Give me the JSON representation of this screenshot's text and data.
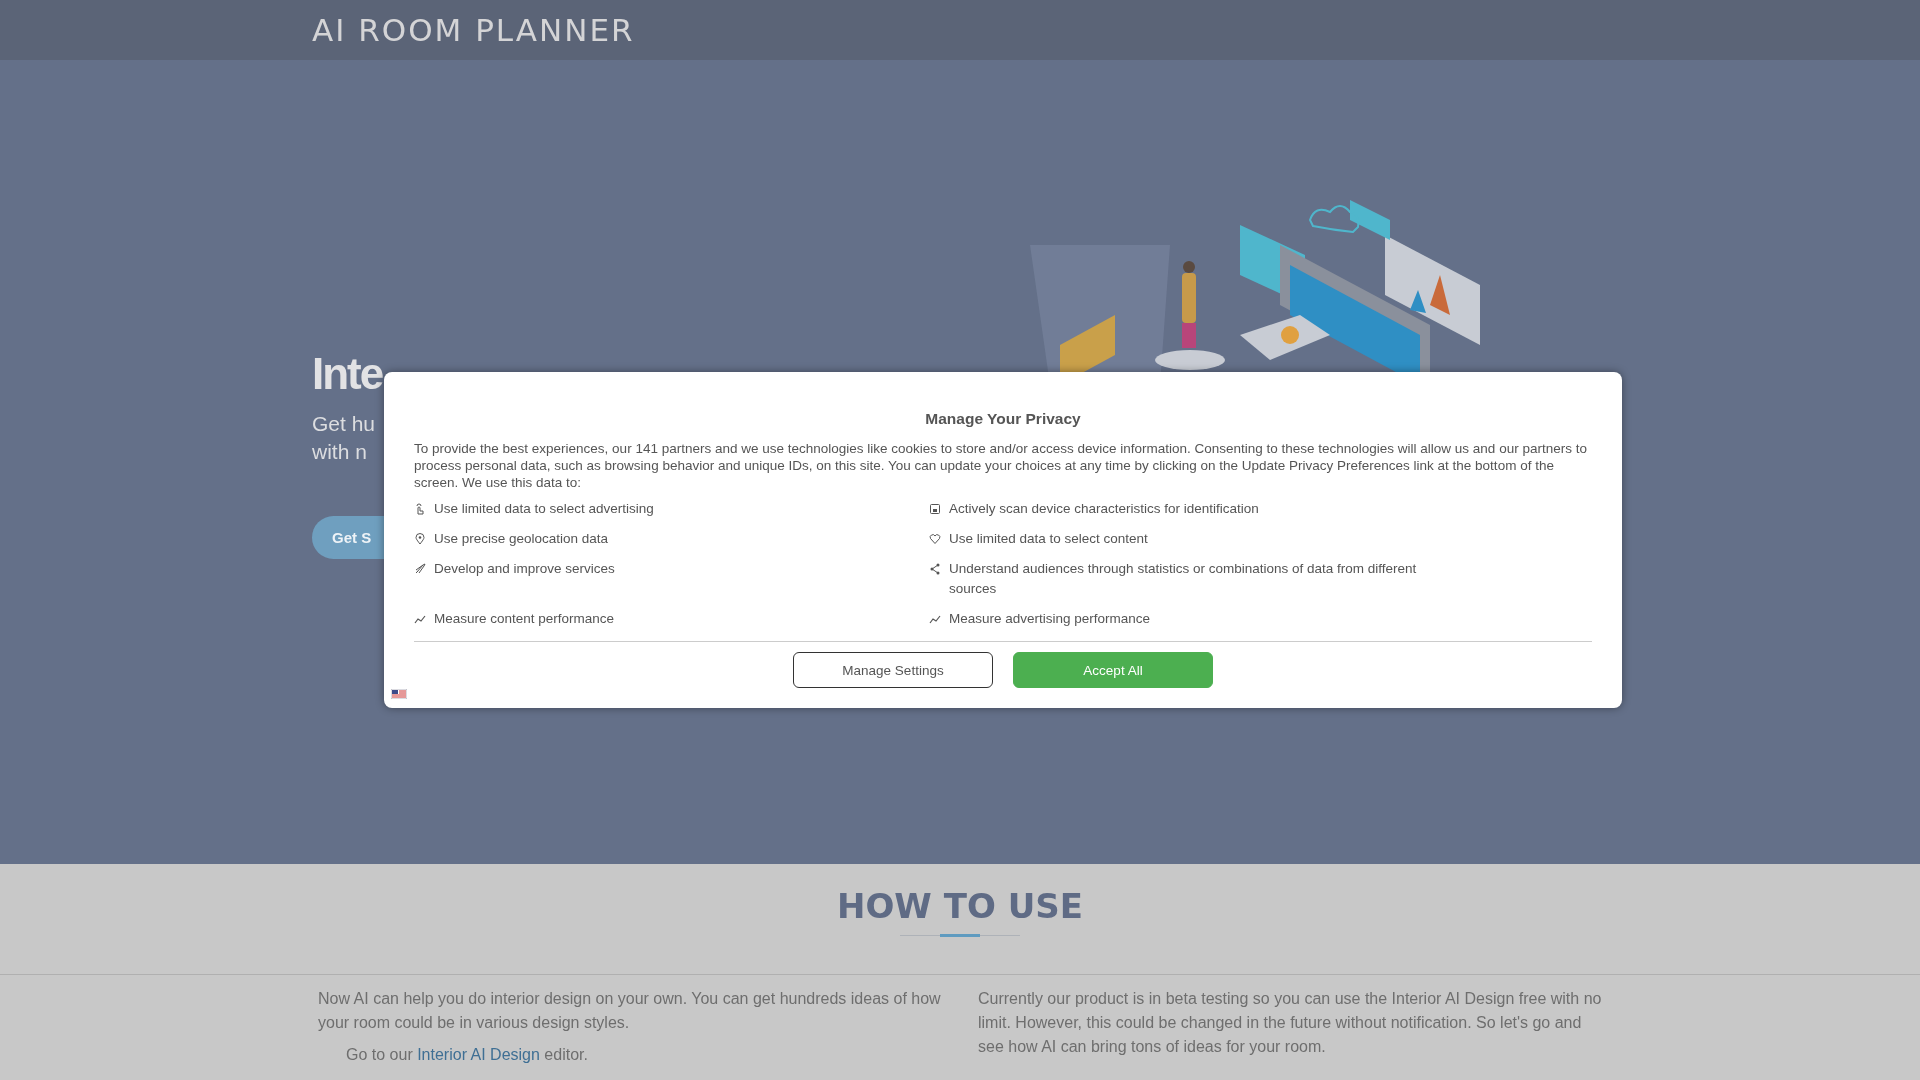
{
  "header": {
    "title": "AI ROOM PLANNER"
  },
  "hero": {
    "title": "Inte",
    "subtitle_lines": [
      "Get hu",
      "with n"
    ],
    "button": "Get S"
  },
  "privacy_dialog": {
    "title": "Manage Your Privacy",
    "intro": "To provide the best experiences, our 141 partners and we use technologies like cookies to store and/or access device information. Consenting to these technologies will allow us and our partners to process personal data, such as browsing behavior and unique IDs, on this site. You can update your choices at any time by clicking on the Update Privacy Preferences link at the bottom of the screen. We use this data to:",
    "purposes": [
      {
        "label": "Use limited data to select advertising"
      },
      {
        "label": "Actively scan device characteristics for identification"
      },
      {
        "label": "Use precise geolocation data"
      },
      {
        "label": "Use limited data to select content"
      },
      {
        "label": "Develop and improve services"
      },
      {
        "label": "Understand audiences through statistics or combinations of data from different sources"
      },
      {
        "label": "Measure content performance"
      },
      {
        "label": "Measure advertising performance"
      }
    ],
    "buttons": [
      {
        "label": "Manage Settings",
        "kind": "outline"
      },
      {
        "label": "Accept All",
        "kind": "primary"
      }
    ]
  },
  "how_to_use": {
    "title": "HOW TO USE",
    "left_paragraph": "Now AI can help you do interior design on your own. You can get hundreds ideas of how your room could be in various design styles.",
    "step": {
      "before": "Go to our ",
      "link": "Interior AI Design",
      "after": " editor."
    },
    "right_paragraph": "Currently our product is in beta testing so you can use the Interior AI Design free with no limit. However, this could be changed in the future without notification. So let's go and see how AI can bring tons of ideas for your room."
  }
}
